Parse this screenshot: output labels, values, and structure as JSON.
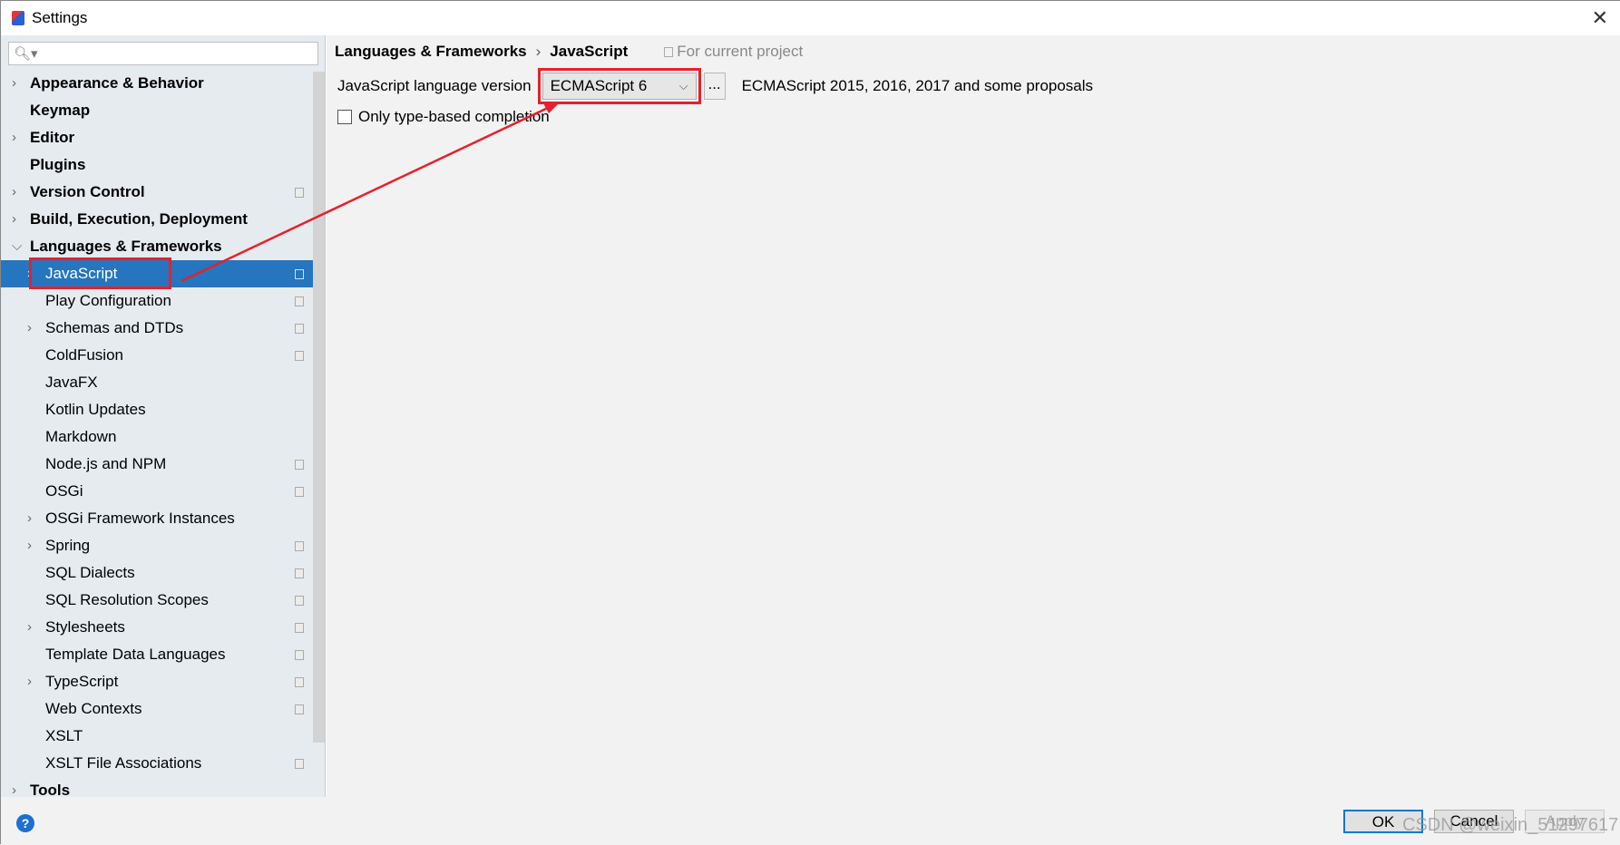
{
  "window": {
    "title": "Settings"
  },
  "search": {
    "placeholder": ""
  },
  "tree": [
    {
      "label": "Appearance & Behavior",
      "level": 0,
      "expandable": true
    },
    {
      "label": "Keymap",
      "level": 0,
      "expandable": false
    },
    {
      "label": "Editor",
      "level": 0,
      "expandable": true
    },
    {
      "label": "Plugins",
      "level": 0,
      "expandable": false
    },
    {
      "label": "Version Control",
      "level": 0,
      "expandable": true,
      "project": true
    },
    {
      "label": "Build, Execution, Deployment",
      "level": 0,
      "expandable": true
    },
    {
      "label": "Languages & Frameworks",
      "level": 0,
      "expandable": true,
      "expanded": true
    },
    {
      "label": "JavaScript",
      "level": 1,
      "expandable": true,
      "project": true,
      "selected": true
    },
    {
      "label": "Play Configuration",
      "level": 1,
      "project": true
    },
    {
      "label": "Schemas and DTDs",
      "level": 1,
      "expandable": true,
      "project": true
    },
    {
      "label": "ColdFusion",
      "level": 1,
      "project": true
    },
    {
      "label": "JavaFX",
      "level": 1
    },
    {
      "label": "Kotlin Updates",
      "level": 1
    },
    {
      "label": "Markdown",
      "level": 1
    },
    {
      "label": "Node.js and NPM",
      "level": 1,
      "project": true
    },
    {
      "label": "OSGi",
      "level": 1,
      "project": true
    },
    {
      "label": "OSGi Framework Instances",
      "level": 1,
      "expandable": true
    },
    {
      "label": "Spring",
      "level": 1,
      "expandable": true,
      "project": true
    },
    {
      "label": "SQL Dialects",
      "level": 1,
      "project": true
    },
    {
      "label": "SQL Resolution Scopes",
      "level": 1,
      "project": true
    },
    {
      "label": "Stylesheets",
      "level": 1,
      "expandable": true,
      "project": true
    },
    {
      "label": "Template Data Languages",
      "level": 1,
      "project": true
    },
    {
      "label": "TypeScript",
      "level": 1,
      "expandable": true,
      "project": true
    },
    {
      "label": "Web Contexts",
      "level": 1,
      "project": true
    },
    {
      "label": "XSLT",
      "level": 1
    },
    {
      "label": "XSLT File Associations",
      "level": 1,
      "project": true
    },
    {
      "label": "Tools",
      "level": 0,
      "expandable": true
    }
  ],
  "breadcrumb": {
    "parent": "Languages & Frameworks",
    "sep": "›",
    "current": "JavaScript",
    "scope": "For current project"
  },
  "settings": {
    "version_label": "JavaScript language version",
    "version_value": "ECMAScript 6",
    "more_label": "...",
    "version_desc": "ECMAScript 2015, 2016, 2017 and some proposals",
    "type_completion_label": "Only type-based completion",
    "type_completion_checked": false
  },
  "footer": {
    "help": "?",
    "ok": "OK",
    "cancel": "Cancel",
    "apply": "Apply",
    "watermark": "CSDN @weixin_51297617"
  },
  "colors": {
    "selection": "#2675bf",
    "annotation": "#e8202a",
    "focus": "#0078d7"
  }
}
